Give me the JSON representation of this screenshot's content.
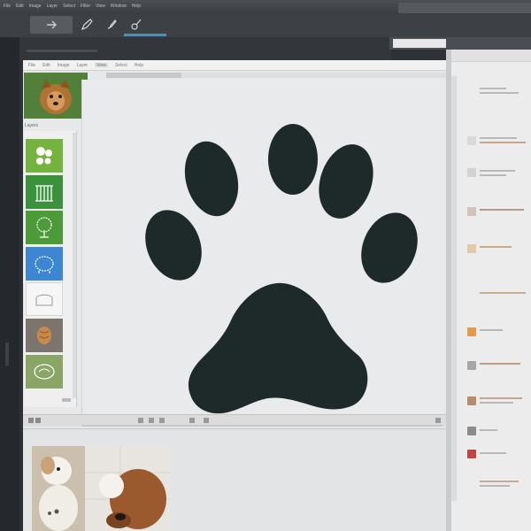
{
  "app": {
    "menu": [
      "File",
      "Edit",
      "Image",
      "Layer",
      "Select",
      "Filter",
      "View",
      "Window",
      "Help"
    ]
  },
  "toolbar": {
    "tools": [
      "pencil-icon",
      "brush-icon",
      "paint-icon"
    ]
  },
  "editor": {
    "menu": [
      "File",
      "Edit",
      "Image",
      "Layer",
      "View",
      "Select",
      "Help"
    ],
    "panel_label": "Layers",
    "canvas_shape": "paw-print-icon"
  },
  "panel": {
    "swatches": [
      {
        "name": "paw-pattern-icon",
        "color": "#74b33d"
      },
      {
        "name": "cage-icon",
        "color": "#3c913c"
      },
      {
        "name": "tree-icon",
        "color": "#4d9b38"
      },
      {
        "name": "sheep-icon",
        "color": "#3c86d4"
      },
      {
        "name": "bread-icon",
        "color": "#f6f6f6"
      },
      {
        "name": "dog-fur-icon",
        "color": "#7b756d"
      },
      {
        "name": "badge-icon",
        "color": "#89a667"
      }
    ]
  },
  "colors": {
    "paw": "#1d2a29",
    "canvas": "#e9eaeb",
    "app_bg": "#2e3136"
  }
}
